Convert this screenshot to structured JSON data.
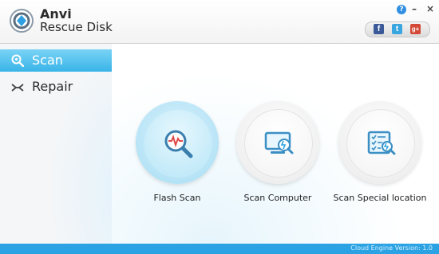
{
  "app": {
    "brand_line1": "Anvi",
    "brand_line2": "Rescue Disk"
  },
  "window_controls": {
    "help": "?",
    "minimize": "–",
    "close": "×"
  },
  "social": {
    "facebook": "f",
    "twitter": "t",
    "googleplus": "g+"
  },
  "sidebar": {
    "items": [
      {
        "label": "Scan",
        "icon": "scan-magnifier-icon",
        "selected": true
      },
      {
        "label": "Repair",
        "icon": "repair-wrench-icon",
        "selected": false
      }
    ]
  },
  "actions": [
    {
      "label": "Flash Scan",
      "icon": "flash-scan-icon",
      "active": true
    },
    {
      "label": "Scan Computer",
      "icon": "scan-computer-icon",
      "active": false
    },
    {
      "label": "Scan Special location",
      "icon": "scan-special-location-icon",
      "active": false
    }
  ],
  "footer": {
    "version": "Cloud Engine Version: 1.0"
  },
  "colors": {
    "accent": "#39b4e8",
    "footer": "#2aa2e3"
  }
}
